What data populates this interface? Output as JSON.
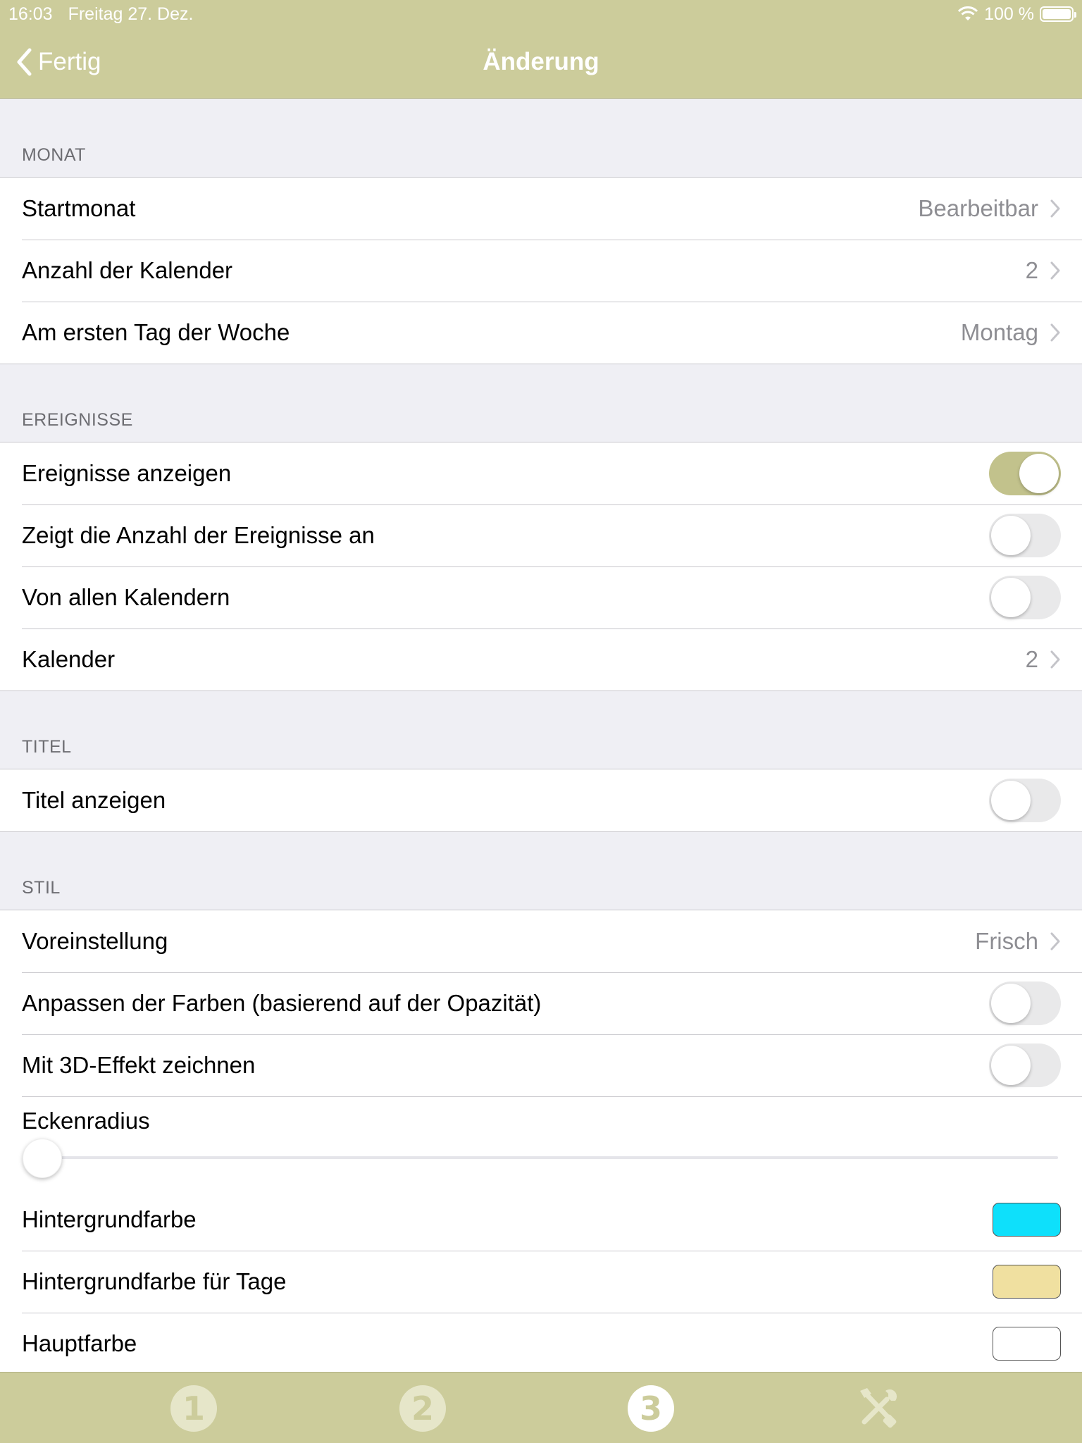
{
  "status": {
    "time": "16:03",
    "date": "Freitag 27. Dez.",
    "battery": "100 %"
  },
  "nav": {
    "back_label": "Fertig",
    "title": "Änderung"
  },
  "sections": {
    "monat": {
      "header": "MONAT",
      "startmonat": {
        "label": "Startmonat",
        "value": "Bearbeitbar"
      },
      "anzahl": {
        "label": "Anzahl der Kalender",
        "value": "2"
      },
      "ersterTag": {
        "label": "Am ersten Tag der Woche",
        "value": "Montag"
      }
    },
    "ereignisse": {
      "header": "EREIGNISSE",
      "anzeigen": {
        "label": "Ereignisse anzeigen",
        "on": true
      },
      "anzahlAnzeigen": {
        "label": "Zeigt die Anzahl der Ereignisse an",
        "on": false
      },
      "alleKalender": {
        "label": "Von allen Kalendern",
        "on": false
      },
      "kalender": {
        "label": "Kalender",
        "value": "2"
      }
    },
    "titel": {
      "header": "TITEL",
      "anzeigen": {
        "label": "Titel anzeigen",
        "on": false
      }
    },
    "stil": {
      "header": "STIL",
      "voreinstellung": {
        "label": "Voreinstellung",
        "value": "Frisch"
      },
      "farbenAnpassen": {
        "label": "Anpassen der Farben (basierend auf der Opazität)",
        "on": false
      },
      "effekt3d": {
        "label": "Mit 3D-Effekt zeichnen",
        "on": false
      },
      "eckenradius": {
        "label": "Eckenradius",
        "level": 0
      },
      "hintergrundfarbe": {
        "label": "Hintergrundfarbe",
        "color": "#0ee0fb"
      },
      "hintergrundTage": {
        "label": "Hintergrundfarbe für Tage",
        "color": "#f0e0a0"
      },
      "hauptfarbe": {
        "label": "Hauptfarbe",
        "color": "#ffffff"
      }
    }
  },
  "tabs": [
    {
      "label": "1",
      "icon": "circle-1-icon",
      "active": false
    },
    {
      "label": "2",
      "icon": "circle-2-icon",
      "active": false
    },
    {
      "label": "3",
      "icon": "circle-3-icon",
      "active": true
    },
    {
      "label": "",
      "icon": "tools-icon",
      "active": false
    }
  ],
  "colors": {
    "bar": "#cccc9b",
    "toggle_on": "#c2c28c"
  }
}
